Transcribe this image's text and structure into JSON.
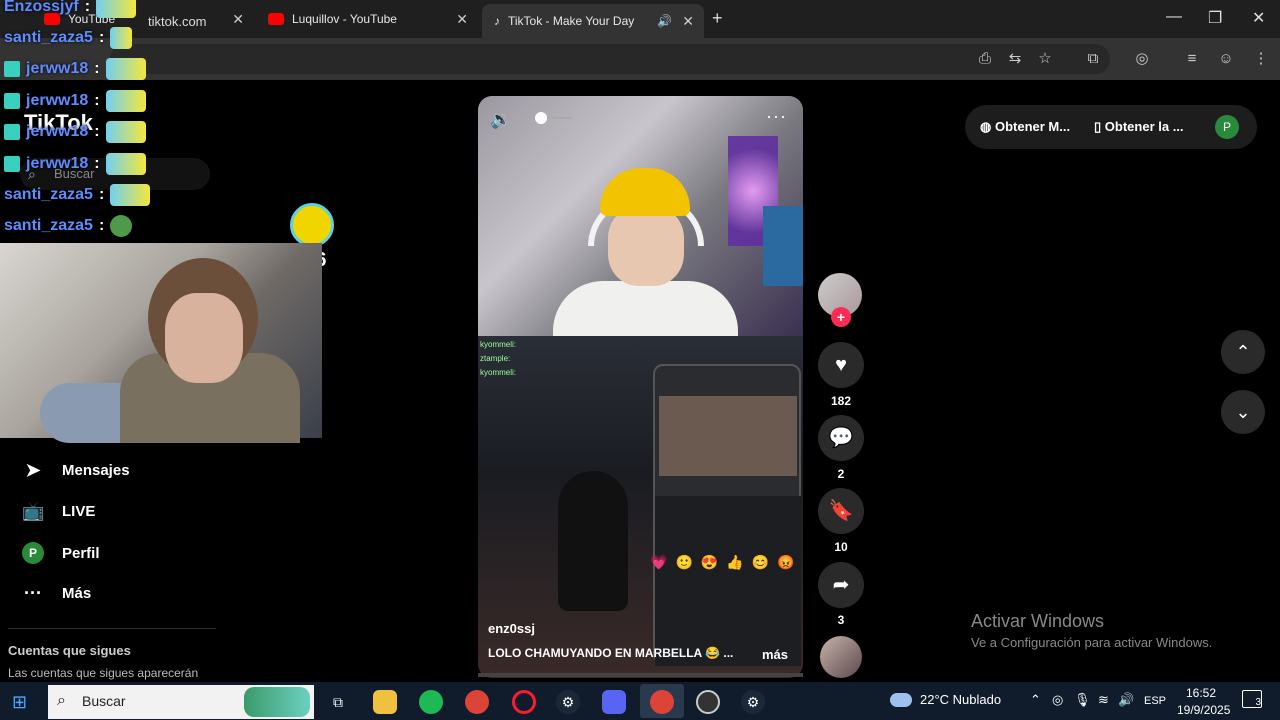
{
  "browser": {
    "tabs": [
      {
        "title": "YouTube",
        "favicon_color": "#ff0000"
      },
      {
        "title": "Luquillov - YouTube",
        "favicon_color": "#ff0000"
      },
      {
        "title": "TikTok - Make Your Day",
        "favicon_color": "#ffffff"
      }
    ],
    "new_tab": "+",
    "url": "tiktok.com",
    "window_controls": {
      "minimize": "—",
      "maximize": "❐",
      "close": "✕"
    }
  },
  "overlay_chat": [
    {
      "user": "Enzossjyf",
      "color": "user-blue",
      "emote": "emote"
    },
    {
      "user": "santi_zaza5",
      "color": "user-blue",
      "emote": "emote"
    },
    {
      "user": "jerww18",
      "color": "user-blue",
      "emote": "emote"
    },
    {
      "user": "jerww18",
      "color": "user-blue",
      "emote": "emote"
    },
    {
      "user": "jerww18",
      "color": "user-blue",
      "emote": "emote"
    },
    {
      "user": "jerww18",
      "color": "user-blue",
      "emote": "emote"
    },
    {
      "user": "santi_zaza5",
      "color": "user-blue",
      "emote": "emote"
    },
    {
      "user": "santi_zaza5",
      "color": "user-blue",
      "emote": "frog"
    }
  ],
  "donation": {
    "multiplier": "X6"
  },
  "tiktok_left": {
    "logo": "TikTok",
    "search_placeholder": "Buscar",
    "nav": [
      {
        "label": "Mensajes",
        "icon": "send-icon"
      },
      {
        "label": "LIVE",
        "icon": "live-icon"
      },
      {
        "label": "Perfil",
        "icon": "avatar-icon",
        "avatar_letter": "P"
      },
      {
        "label": "Más",
        "icon": "more-icon"
      }
    ],
    "following_title": "Cuentas que sigues",
    "following_sub": "Las cuentas que sigues aparecerán"
  },
  "video": {
    "author": "enz0ssj",
    "caption": "LOLO CHAMUYANDO EN MARBELLA 😂 ...",
    "more": "más",
    "volume_level": 0.35
  },
  "actions": {
    "likes": "182",
    "comments": "2",
    "saves": "10",
    "shares": "3"
  },
  "top_right": {
    "btn1": "Obtener M...",
    "btn2": "Obtener la ...",
    "avatar_letter": "P"
  },
  "activate_windows": {
    "title": "Activar Windows",
    "subtitle": "Ve a Configuración para activar Windows."
  },
  "taskbar": {
    "search": "Buscar",
    "weather": "22°C  Nublado",
    "lang": "ESP",
    "time": "16:52",
    "date": "19/9/2025",
    "notifications": "3"
  }
}
